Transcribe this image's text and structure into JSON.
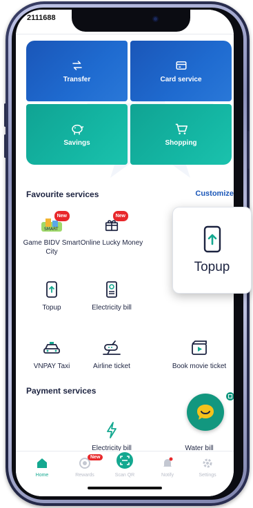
{
  "status": {
    "number": "2111688"
  },
  "quick_actions": [
    {
      "label": "Transfer",
      "icon": "transfer-icon"
    },
    {
      "label": "Card service",
      "icon": "card-icon"
    },
    {
      "label": "Savings",
      "icon": "piggy-bank-icon"
    },
    {
      "label": "Shopping",
      "icon": "cart-icon"
    }
  ],
  "favourites": {
    "title": "Favourite services",
    "customize": "Customize",
    "badge_new": "New",
    "items": [
      {
        "label": "Game BIDV Smart City",
        "icon": "smart-city-icon",
        "new": true
      },
      {
        "label": "Online Lucky Money",
        "icon": "gift-icon",
        "new": true
      },
      {
        "label": "Topup",
        "icon": "phone-topup-icon"
      },
      {
        "label": "Electricity bill",
        "icon": "electricity-bill-icon"
      },
      {
        "label": "VNPAY Taxi",
        "icon": "taxi-icon"
      },
      {
        "label": "Airline ticket",
        "icon": "airplane-icon"
      },
      {
        "label": "Book movie ticket",
        "icon": "movie-icon"
      }
    ]
  },
  "payment": {
    "title": "Payment services",
    "items": [
      {
        "label": "Electricity bill",
        "icon": "lightning-icon"
      },
      {
        "label": "Water bill",
        "icon": "water-drop-icon"
      }
    ]
  },
  "topup_card": {
    "label": "Topup",
    "icon": "phone-topup-icon"
  },
  "nav": {
    "home": "Home",
    "rewards": "Rewards",
    "rewards_badge": "New",
    "scan": "Scan QR",
    "notify": "Notify",
    "settings": "Settings"
  },
  "colors": {
    "accent_blue": "#1a56b8",
    "accent_teal": "#14a890",
    "badge_red": "#e8282b"
  }
}
